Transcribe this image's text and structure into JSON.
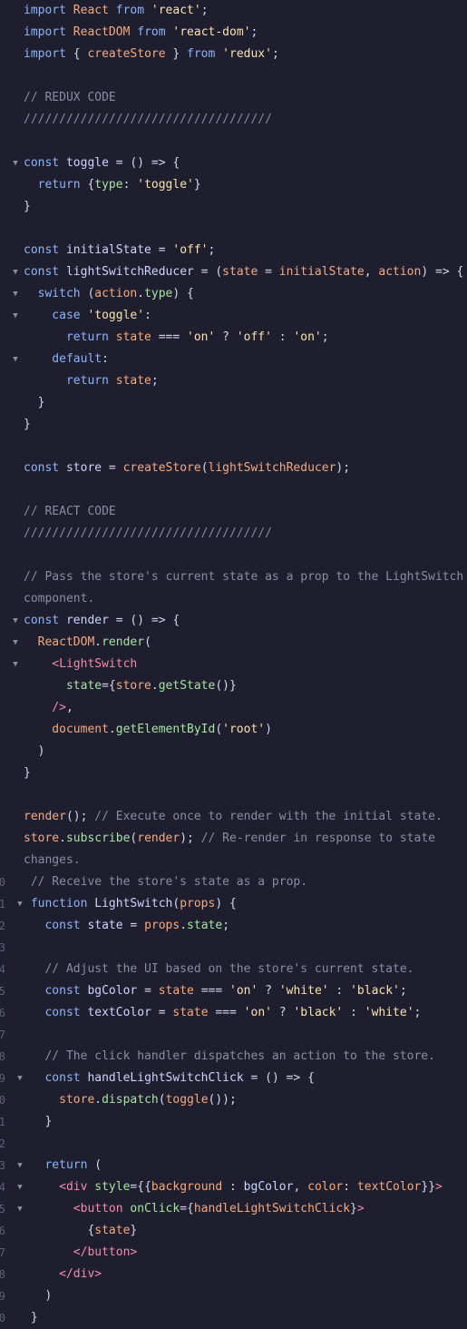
{
  "colors": {
    "background": "#1e1e2e",
    "keyword": "#89b4fa",
    "function": "#f5a97f",
    "string": "#f9e2af",
    "comment": "#8a8ca6",
    "tag": "#f38ba8"
  },
  "fold_icon": "chevron-down-icon",
  "lines": [
    {
      "tokens": [
        [
          "kw",
          "import "
        ],
        [
          "fn",
          "React"
        ],
        [
          "kw",
          " from "
        ],
        [
          "str",
          "'react'"
        ],
        [
          "tx",
          ";"
        ]
      ]
    },
    {
      "tokens": [
        [
          "kw",
          "import "
        ],
        [
          "fn",
          "ReactDOM"
        ],
        [
          "kw",
          " from "
        ],
        [
          "str",
          "'react-dom'"
        ],
        [
          "tx",
          ";"
        ]
      ]
    },
    {
      "tokens": [
        [
          "kw",
          "import "
        ],
        [
          "tx",
          "{ "
        ],
        [
          "fn",
          "createStore"
        ],
        [
          "tx",
          " } "
        ],
        [
          "kw",
          "from "
        ],
        [
          "str",
          "'redux'"
        ],
        [
          "tx",
          ";"
        ]
      ]
    },
    {
      "tokens": []
    },
    {
      "tokens": [
        [
          "cm",
          "// REDUX CODE"
        ]
      ]
    },
    {
      "tokens": [
        [
          "cm",
          "///////////////////////////////////"
        ]
      ]
    },
    {
      "tokens": []
    },
    {
      "fold": true,
      "tokens": [
        [
          "kw",
          "const "
        ],
        [
          "id",
          "toggle"
        ],
        [
          "tx",
          " = () => {"
        ]
      ]
    },
    {
      "tokens": [
        [
          "kw",
          "  return "
        ],
        [
          "tx",
          "{"
        ],
        [
          "prop",
          "type"
        ],
        [
          "tx",
          ": "
        ],
        [
          "str",
          "'toggle'"
        ],
        [
          "tx",
          "}"
        ]
      ]
    },
    {
      "tokens": [
        [
          "tx",
          "}"
        ]
      ]
    },
    {
      "tokens": []
    },
    {
      "tokens": [
        [
          "kw",
          "const "
        ],
        [
          "id",
          "initialState"
        ],
        [
          "tx",
          " = "
        ],
        [
          "str",
          "'off'"
        ],
        [
          "tx",
          ";"
        ]
      ]
    },
    {
      "fold": true,
      "tokens": [
        [
          "kw",
          "const "
        ],
        [
          "id",
          "lightSwitchReducer"
        ],
        [
          "tx",
          " = ("
        ],
        [
          "fn",
          "state"
        ],
        [
          "tx",
          " = "
        ],
        [
          "fn",
          "initialState"
        ],
        [
          "tx",
          ", "
        ],
        [
          "fn",
          "action"
        ],
        [
          "tx",
          ") => {"
        ]
      ]
    },
    {
      "fold": true,
      "tokens": [
        [
          "kw",
          "  switch "
        ],
        [
          "tx",
          "("
        ],
        [
          "fn",
          "action"
        ],
        [
          "tx",
          "."
        ],
        [
          "prop",
          "type"
        ],
        [
          "tx",
          ") {"
        ]
      ]
    },
    {
      "fold": true,
      "tokens": [
        [
          "kw",
          "    case "
        ],
        [
          "str",
          "'toggle'"
        ],
        [
          "tx",
          ":"
        ]
      ]
    },
    {
      "tokens": [
        [
          "kw",
          "      return "
        ],
        [
          "fn",
          "state"
        ],
        [
          "tx",
          " === "
        ],
        [
          "str",
          "'on'"
        ],
        [
          "tx",
          " ? "
        ],
        [
          "str",
          "'off'"
        ],
        [
          "tx",
          " : "
        ],
        [
          "str",
          "'on'"
        ],
        [
          "tx",
          ";"
        ]
      ]
    },
    {
      "fold": true,
      "tokens": [
        [
          "kw",
          "    default"
        ],
        [
          "tx",
          ":"
        ]
      ]
    },
    {
      "tokens": [
        [
          "kw",
          "      return "
        ],
        [
          "fn",
          "state"
        ],
        [
          "tx",
          ";"
        ]
      ]
    },
    {
      "tokens": [
        [
          "tx",
          "  }"
        ]
      ]
    },
    {
      "tokens": [
        [
          "tx",
          "}"
        ]
      ]
    },
    {
      "tokens": []
    },
    {
      "tokens": [
        [
          "kw",
          "const "
        ],
        [
          "id",
          "store"
        ],
        [
          "tx",
          " = "
        ],
        [
          "fn",
          "createStore"
        ],
        [
          "tx",
          "("
        ],
        [
          "fn",
          "lightSwitchReducer"
        ],
        [
          "tx",
          ");"
        ]
      ]
    },
    {
      "tokens": []
    },
    {
      "tokens": [
        [
          "cm",
          "// REACT CODE"
        ]
      ]
    },
    {
      "tokens": [
        [
          "cm",
          "///////////////////////////////////"
        ]
      ]
    },
    {
      "tokens": []
    },
    {
      "tokens": [
        [
          "cm",
          "// Pass the store's current state as a prop to the LightSwitch"
        ]
      ]
    },
    {
      "tokens": [
        [
          "cm",
          "component."
        ]
      ]
    },
    {
      "fold": true,
      "tokens": [
        [
          "kw",
          "const "
        ],
        [
          "id",
          "render"
        ],
        [
          "tx",
          " = () => {"
        ]
      ]
    },
    {
      "fold": true,
      "tokens": [
        [
          "fn",
          "  ReactDOM"
        ],
        [
          "tx",
          "."
        ],
        [
          "prop",
          "render"
        ],
        [
          "tx",
          "("
        ]
      ]
    },
    {
      "fold": true,
      "tokens": [
        [
          "tag",
          "    <LightSwitch"
        ]
      ]
    },
    {
      "tokens": [
        [
          "prop",
          "      state"
        ],
        [
          "tx",
          "={"
        ],
        [
          "fn",
          "store"
        ],
        [
          "tx",
          "."
        ],
        [
          "prop",
          "getState"
        ],
        [
          "tx",
          "()}"
        ]
      ]
    },
    {
      "tokens": [
        [
          "tag",
          "    />"
        ],
        [
          "tx",
          ","
        ]
      ]
    },
    {
      "tokens": [
        [
          "fn",
          "    document"
        ],
        [
          "tx",
          "."
        ],
        [
          "prop",
          "getElementById"
        ],
        [
          "tx",
          "("
        ],
        [
          "str",
          "'root'"
        ],
        [
          "tx",
          ")"
        ]
      ]
    },
    {
      "tokens": [
        [
          "tx",
          "  )"
        ]
      ]
    },
    {
      "tokens": [
        [
          "tx",
          "}"
        ]
      ]
    },
    {
      "tokens": []
    },
    {
      "tokens": [
        [
          "fn",
          "render"
        ],
        [
          "tx",
          "(); "
        ],
        [
          "cm",
          "// Execute once to render with the initial state."
        ]
      ]
    },
    {
      "tokens": [
        [
          "fn",
          "store"
        ],
        [
          "tx",
          "."
        ],
        [
          "prop",
          "subscribe"
        ],
        [
          "tx",
          "("
        ],
        [
          "fn",
          "render"
        ],
        [
          "tx",
          "); "
        ],
        [
          "cm",
          "// Re-render in response to state"
        ]
      ]
    },
    {
      "tokens": [
        [
          "cm",
          "changes."
        ]
      ]
    },
    {
      "ln": "0",
      "tokens": [
        [
          "cm",
          " // Receive the store's state as a prop."
        ]
      ]
    },
    {
      "ln": "1",
      "fold": true,
      "tokens": [
        [
          "kw",
          " function "
        ],
        [
          "id",
          "LightSwitch"
        ],
        [
          "tx",
          "("
        ],
        [
          "fn",
          "props"
        ],
        [
          "tx",
          ") {"
        ]
      ]
    },
    {
      "ln": "2",
      "tokens": [
        [
          "kw",
          "   const "
        ],
        [
          "id",
          "state"
        ],
        [
          "tx",
          " = "
        ],
        [
          "fn",
          "props"
        ],
        [
          "tx",
          "."
        ],
        [
          "prop",
          "state"
        ],
        [
          "tx",
          ";"
        ]
      ]
    },
    {
      "ln": "3",
      "tokens": []
    },
    {
      "ln": "4",
      "tokens": [
        [
          "cm",
          "   // Adjust the UI based on the store's current state."
        ]
      ]
    },
    {
      "ln": "5",
      "tokens": [
        [
          "kw",
          "   const "
        ],
        [
          "id",
          "bgColor"
        ],
        [
          "tx",
          " = "
        ],
        [
          "fn",
          "state"
        ],
        [
          "tx",
          " === "
        ],
        [
          "str",
          "'on'"
        ],
        [
          "tx",
          " ? "
        ],
        [
          "str",
          "'white'"
        ],
        [
          "tx",
          " : "
        ],
        [
          "str",
          "'black'"
        ],
        [
          "tx",
          ";"
        ]
      ]
    },
    {
      "ln": "6",
      "tokens": [
        [
          "kw",
          "   const "
        ],
        [
          "id",
          "textColor"
        ],
        [
          "tx",
          " = "
        ],
        [
          "fn",
          "state"
        ],
        [
          "tx",
          " === "
        ],
        [
          "str",
          "'on'"
        ],
        [
          "tx",
          " ? "
        ],
        [
          "str",
          "'black'"
        ],
        [
          "tx",
          " : "
        ],
        [
          "str",
          "'white'"
        ],
        [
          "tx",
          ";"
        ]
      ]
    },
    {
      "ln": "7",
      "tokens": []
    },
    {
      "ln": "8",
      "tokens": [
        [
          "cm",
          "   // The click handler dispatches an action to the store."
        ]
      ]
    },
    {
      "ln": "9",
      "fold": true,
      "tokens": [
        [
          "kw",
          "   const "
        ],
        [
          "id",
          "handleLightSwitchClick"
        ],
        [
          "tx",
          " = () => {"
        ]
      ]
    },
    {
      "ln": "0",
      "tokens": [
        [
          "fn",
          "     store"
        ],
        [
          "tx",
          "."
        ],
        [
          "prop",
          "dispatch"
        ],
        [
          "tx",
          "("
        ],
        [
          "fn",
          "toggle"
        ],
        [
          "tx",
          "());"
        ]
      ]
    },
    {
      "ln": "1",
      "tokens": [
        [
          "tx",
          "   }"
        ]
      ]
    },
    {
      "ln": "2",
      "tokens": []
    },
    {
      "ln": "3",
      "fold": true,
      "tokens": [
        [
          "kw",
          "   return "
        ],
        [
          "tx",
          "("
        ]
      ]
    },
    {
      "ln": "4",
      "fold": true,
      "tokens": [
        [
          "tag",
          "     <div "
        ],
        [
          "prop",
          "style"
        ],
        [
          "tx",
          "={{"
        ],
        [
          "fn",
          "background"
        ],
        [
          "tx",
          " : "
        ],
        [
          "id",
          "bgColor"
        ],
        [
          "tx",
          ", "
        ],
        [
          "fn",
          "color"
        ],
        [
          "tx",
          ": "
        ],
        [
          "fn",
          "textColor"
        ],
        [
          "tx",
          "}}"
        ],
        [
          "tag",
          ">"
        ]
      ]
    },
    {
      "ln": "5",
      "fold": true,
      "tokens": [
        [
          "tag",
          "       <button "
        ],
        [
          "prop",
          "onClick"
        ],
        [
          "tx",
          "={"
        ],
        [
          "fn",
          "handleLightSwitchClick"
        ],
        [
          "tx",
          "}"
        ],
        [
          "tag",
          ">"
        ]
      ]
    },
    {
      "ln": "6",
      "tokens": [
        [
          "tx",
          "         {"
        ],
        [
          "fn",
          "state"
        ],
        [
          "tx",
          "}"
        ]
      ]
    },
    {
      "ln": "7",
      "tokens": [
        [
          "tag",
          "       </button>"
        ]
      ]
    },
    {
      "ln": "8",
      "tokens": [
        [
          "tag",
          "     </div>"
        ]
      ]
    },
    {
      "ln": "9",
      "tokens": [
        [
          "tx",
          "   )"
        ]
      ]
    },
    {
      "ln": "0",
      "tokens": [
        [
          "tx",
          " }"
        ]
      ]
    }
  ]
}
